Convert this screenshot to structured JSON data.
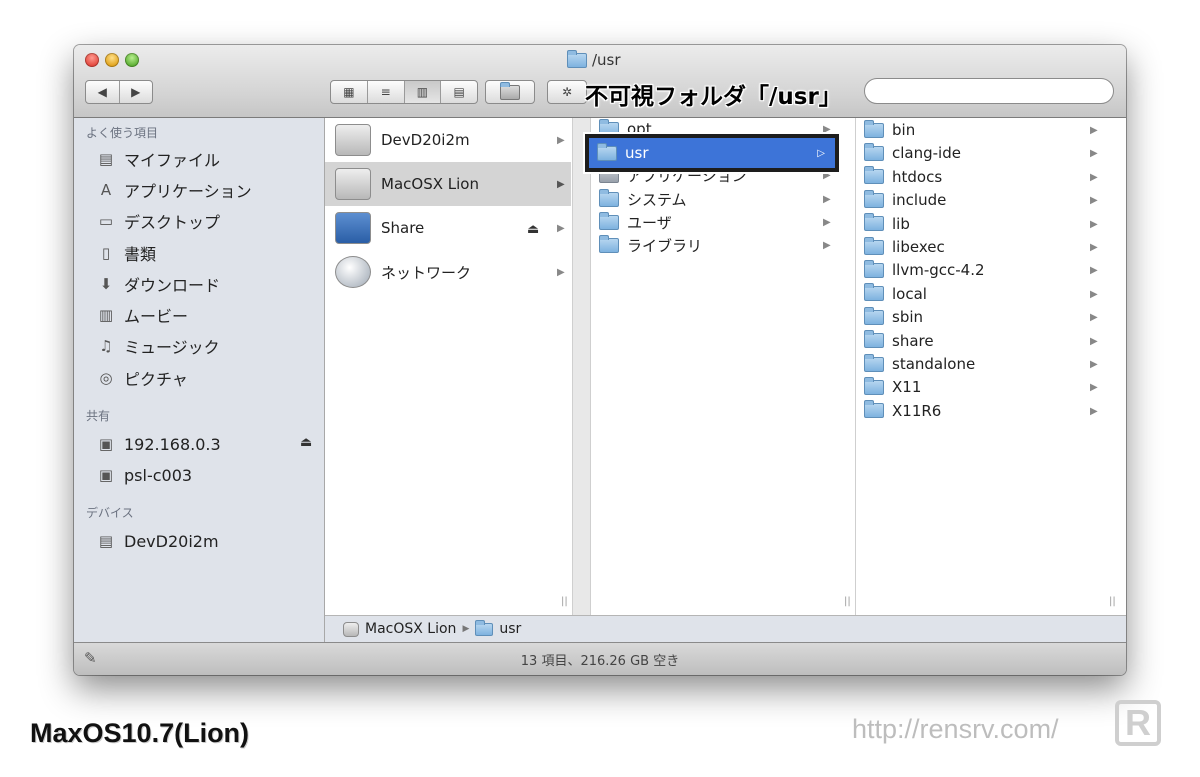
{
  "window": {
    "title": "/usr"
  },
  "toolbar": {
    "back_icon": "◀",
    "forward_icon": "▶",
    "gear_icon": "✲"
  },
  "callout": "不可視フォルダ「/usr」",
  "sidebar": {
    "favorites_heading": "よく使う項目",
    "favorites": [
      {
        "label": "マイファイル",
        "icon": "all-my-files-icon"
      },
      {
        "label": "アプリケーション",
        "icon": "applications-icon"
      },
      {
        "label": "デスクトップ",
        "icon": "desktop-icon"
      },
      {
        "label": "書類",
        "icon": "documents-icon"
      },
      {
        "label": "ダウンロード",
        "icon": "downloads-icon"
      },
      {
        "label": "ムービー",
        "icon": "movies-icon"
      },
      {
        "label": "ミュージック",
        "icon": "music-icon"
      },
      {
        "label": "ピクチャ",
        "icon": "pictures-icon"
      }
    ],
    "shared_heading": "共有",
    "shared": [
      {
        "label": "192.168.0.3"
      },
      {
        "label": "psl-c003"
      }
    ],
    "devices_heading": "デバイス",
    "devices": [
      {
        "label": "DevD20i2m"
      }
    ]
  },
  "column1": [
    {
      "label": "DevD20i2m"
    },
    {
      "label": "MacOSX Lion"
    },
    {
      "label": "Share"
    },
    {
      "label": "ネットワーク"
    }
  ],
  "column2": [
    {
      "label": "opt"
    },
    {
      "label": "usr"
    },
    {
      "label": "アプリケーション"
    },
    {
      "label": "システム"
    },
    {
      "label": "ユーザ"
    },
    {
      "label": "ライブラリ"
    }
  ],
  "column3": [
    "bin",
    "clang-ide",
    "htdocs",
    "include",
    "lib",
    "libexec",
    "llvm-gcc-4.2",
    "local",
    "sbin",
    "share",
    "standalone",
    "X11",
    "X11R6"
  ],
  "pathbar": {
    "volume": "MacOSX Lion",
    "folder": "usr"
  },
  "status": "13 項目、216.26 GB 空き",
  "caption": "MaxOS10.7(Lion)",
  "url": "http://rensrv.com/",
  "logo_letter": "R"
}
